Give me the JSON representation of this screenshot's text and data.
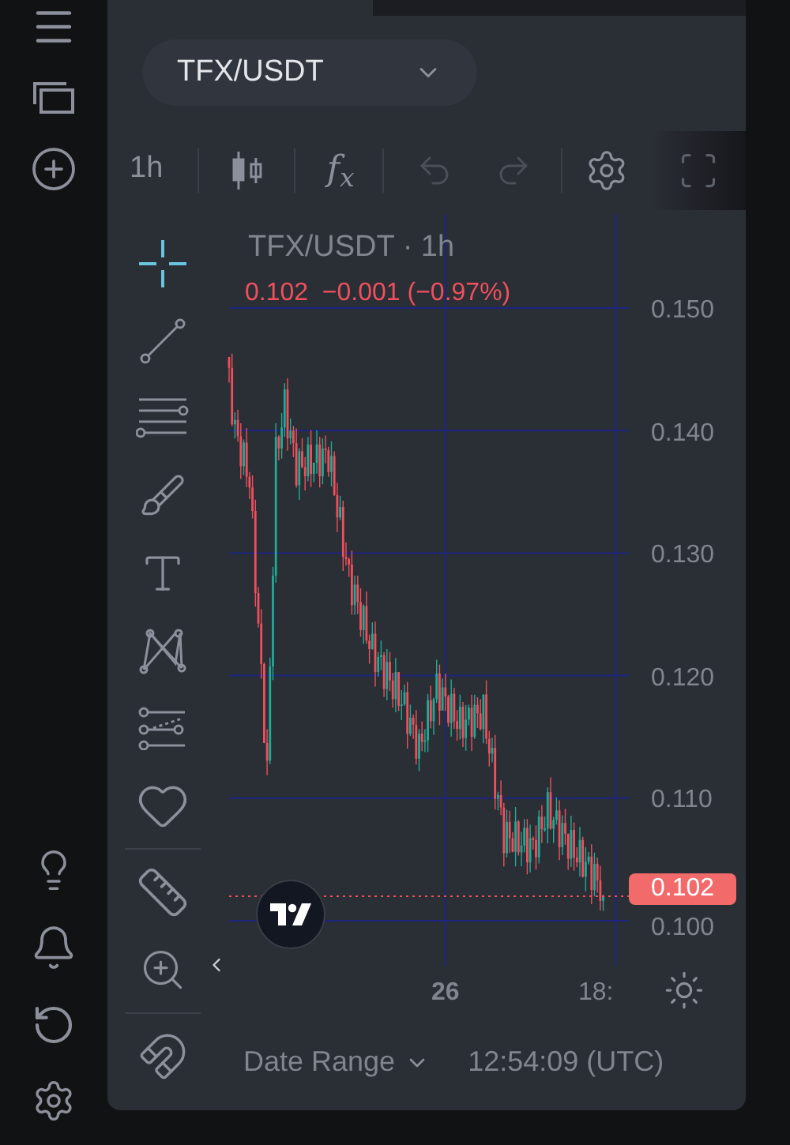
{
  "symbol_selector": {
    "value": "TFX/USDT"
  },
  "toolbar": {
    "interval": "1h",
    "indicators": "f$_{x}$",
    "undo_disabled": true,
    "redo_disabled": true
  },
  "drawing_tools": {
    "groups": [
      {
        "tools": [
          {
            "kind": "crosshair",
            "selected": true
          },
          {
            "kind": "trend-line",
            "selected": false
          },
          {
            "kind": "fib",
            "selected": false
          },
          {
            "kind": "brush",
            "selected": false
          },
          {
            "kind": "text",
            "selected": false
          },
          {
            "kind": "pattern",
            "selected": false
          },
          {
            "kind": "prediction",
            "selected": false
          },
          {
            "kind": "favorites",
            "selected": false
          }
        ]
      },
      {
        "tools": [
          {
            "kind": "ruler",
            "selected": false
          },
          {
            "kind": "zoom",
            "selected": false
          }
        ]
      },
      {
        "tools": [
          {
            "kind": "magnet",
            "selected": false
          }
        ]
      }
    ]
  },
  "legend": {
    "title": "TFX/USDT · 1h",
    "quote": "0.102  −0.001 (−0.97%)"
  },
  "price_axis": {
    "labels": [
      "0.150",
      "0.140",
      "0.130",
      "0.120",
      "0.110",
      "0.100"
    ],
    "last_price": "0.102"
  },
  "time_axis": {
    "labels": [
      "26",
      "18:"
    ]
  },
  "footer": {
    "date_range": "Date Range",
    "time": "12:54:09 (UTC)"
  }
}
